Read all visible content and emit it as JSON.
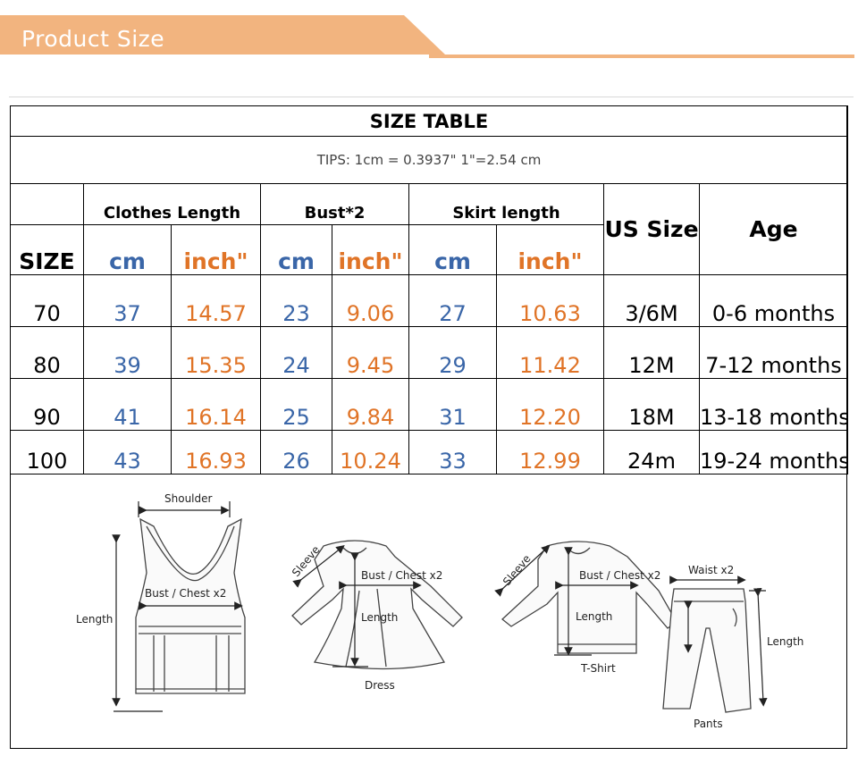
{
  "banner": {
    "title": "Product Size",
    "color": "#f2b47f"
  },
  "table": {
    "title": "SIZE TABLE",
    "tips": "TIPS: 1cm = 0.3937\"   1\"=2.54 cm",
    "groups": [
      "Clothes Length",
      "Bust*2",
      "Skirt length"
    ],
    "size_label": "SIZE",
    "cm_label": "cm",
    "inch_label": "inch\"",
    "us_size_label": "US Size",
    "age_label": "Age",
    "rows": [
      {
        "size": "70",
        "cl_cm": "37",
        "cl_in": "14.57",
        "b_cm": "23",
        "b_in": "9.06",
        "s_cm": "27",
        "s_in": "10.63",
        "us": "3/6M",
        "age": "0-6 months"
      },
      {
        "size": "80",
        "cl_cm": "39",
        "cl_in": "15.35",
        "b_cm": "24",
        "b_in": "9.45",
        "s_cm": "29",
        "s_in": "11.42",
        "us": "12M",
        "age": "7-12 months"
      },
      {
        "size": "90",
        "cl_cm": "41",
        "cl_in": "16.14",
        "b_cm": "25",
        "b_in": "9.84",
        "s_cm": "31",
        "s_in": "12.20",
        "us": "18M",
        "age": "13-18 months"
      },
      {
        "size": "100",
        "cl_cm": "43",
        "cl_in": "16.93",
        "b_cm": "26",
        "b_in": "10.24",
        "s_cm": "33",
        "s_in": "12.99",
        "us": "24m",
        "age": "19-24 months"
      }
    ],
    "colors": {
      "cm": "#3a66a8",
      "inch": "#e07427"
    }
  },
  "diagrams": {
    "vest": {
      "shoulder": "Shoulder",
      "bust": "Bust / Chest x2",
      "length": "Length"
    },
    "dress": {
      "sleeve": "Sleeve",
      "bust": "Bust / Chest x2",
      "length": "Length",
      "caption": "Dress"
    },
    "tshirt": {
      "sleeve": "Sleeve",
      "bust": "Bust / Chest x2",
      "length": "Length",
      "caption": "T-Shirt"
    },
    "pants": {
      "waist": "Waist x2",
      "length": "Length",
      "caption": "Pants"
    }
  }
}
